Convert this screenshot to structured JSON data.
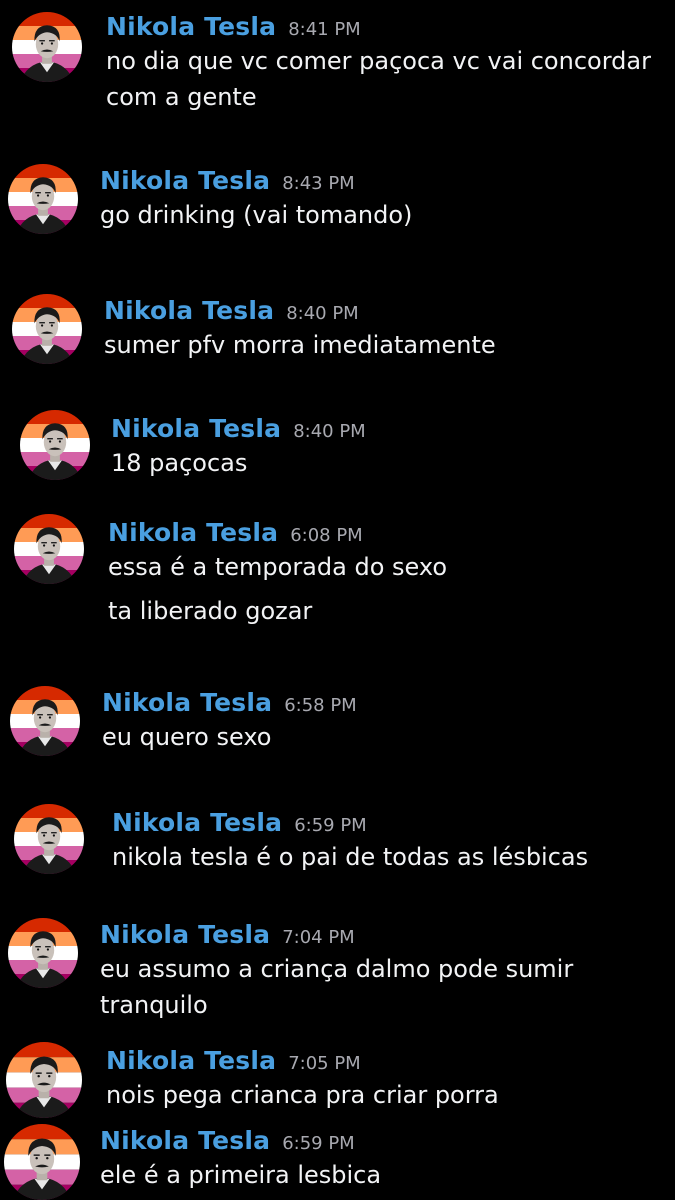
{
  "flag_colors": [
    "#d62900",
    "#ff9b55",
    "#ffffff",
    "#d462a6",
    "#a50062"
  ],
  "avatar_icon": "nikola-tesla-portrait-lesbian-flag",
  "messages": [
    {
      "author": "Nikola Tesla",
      "time": "8:41 PM",
      "text": "no dia que vc comer paçoca vc vai concordar\ncom a gente"
    },
    {
      "author": "Nikola Tesla",
      "time": "8:43 PM",
      "text": "go drinking (vai tomando)"
    },
    {
      "author": "Nikola Tesla",
      "time": "8:40 PM",
      "text": "sumer pfv morra imediatamente"
    },
    {
      "author": "Nikola Tesla",
      "time": "8:40 PM",
      "text": "18 paçocas"
    },
    {
      "author": "Nikola Tesla",
      "time": "6:08 PM",
      "text": "essa é a temporada do sexo",
      "text2": "ta liberado gozar"
    },
    {
      "author": "Nikola Tesla",
      "time": "6:58 PM",
      "text": "eu quero sexo"
    },
    {
      "author": "Nikola Tesla",
      "time": "6:59 PM",
      "text": "nikola tesla é o pai de todas as lésbicas"
    },
    {
      "author": "Nikola Tesla",
      "time": "7:04 PM",
      "text": "eu assumo a criança dalmo pode sumir\ntranquilo"
    },
    {
      "author": "Nikola Tesla",
      "time": "7:05 PM",
      "text": "nois pega crianca pra criar porra"
    },
    {
      "author": "Nikola Tesla",
      "time": "6:59 PM",
      "text": "ele é a primeira lesbica"
    }
  ]
}
